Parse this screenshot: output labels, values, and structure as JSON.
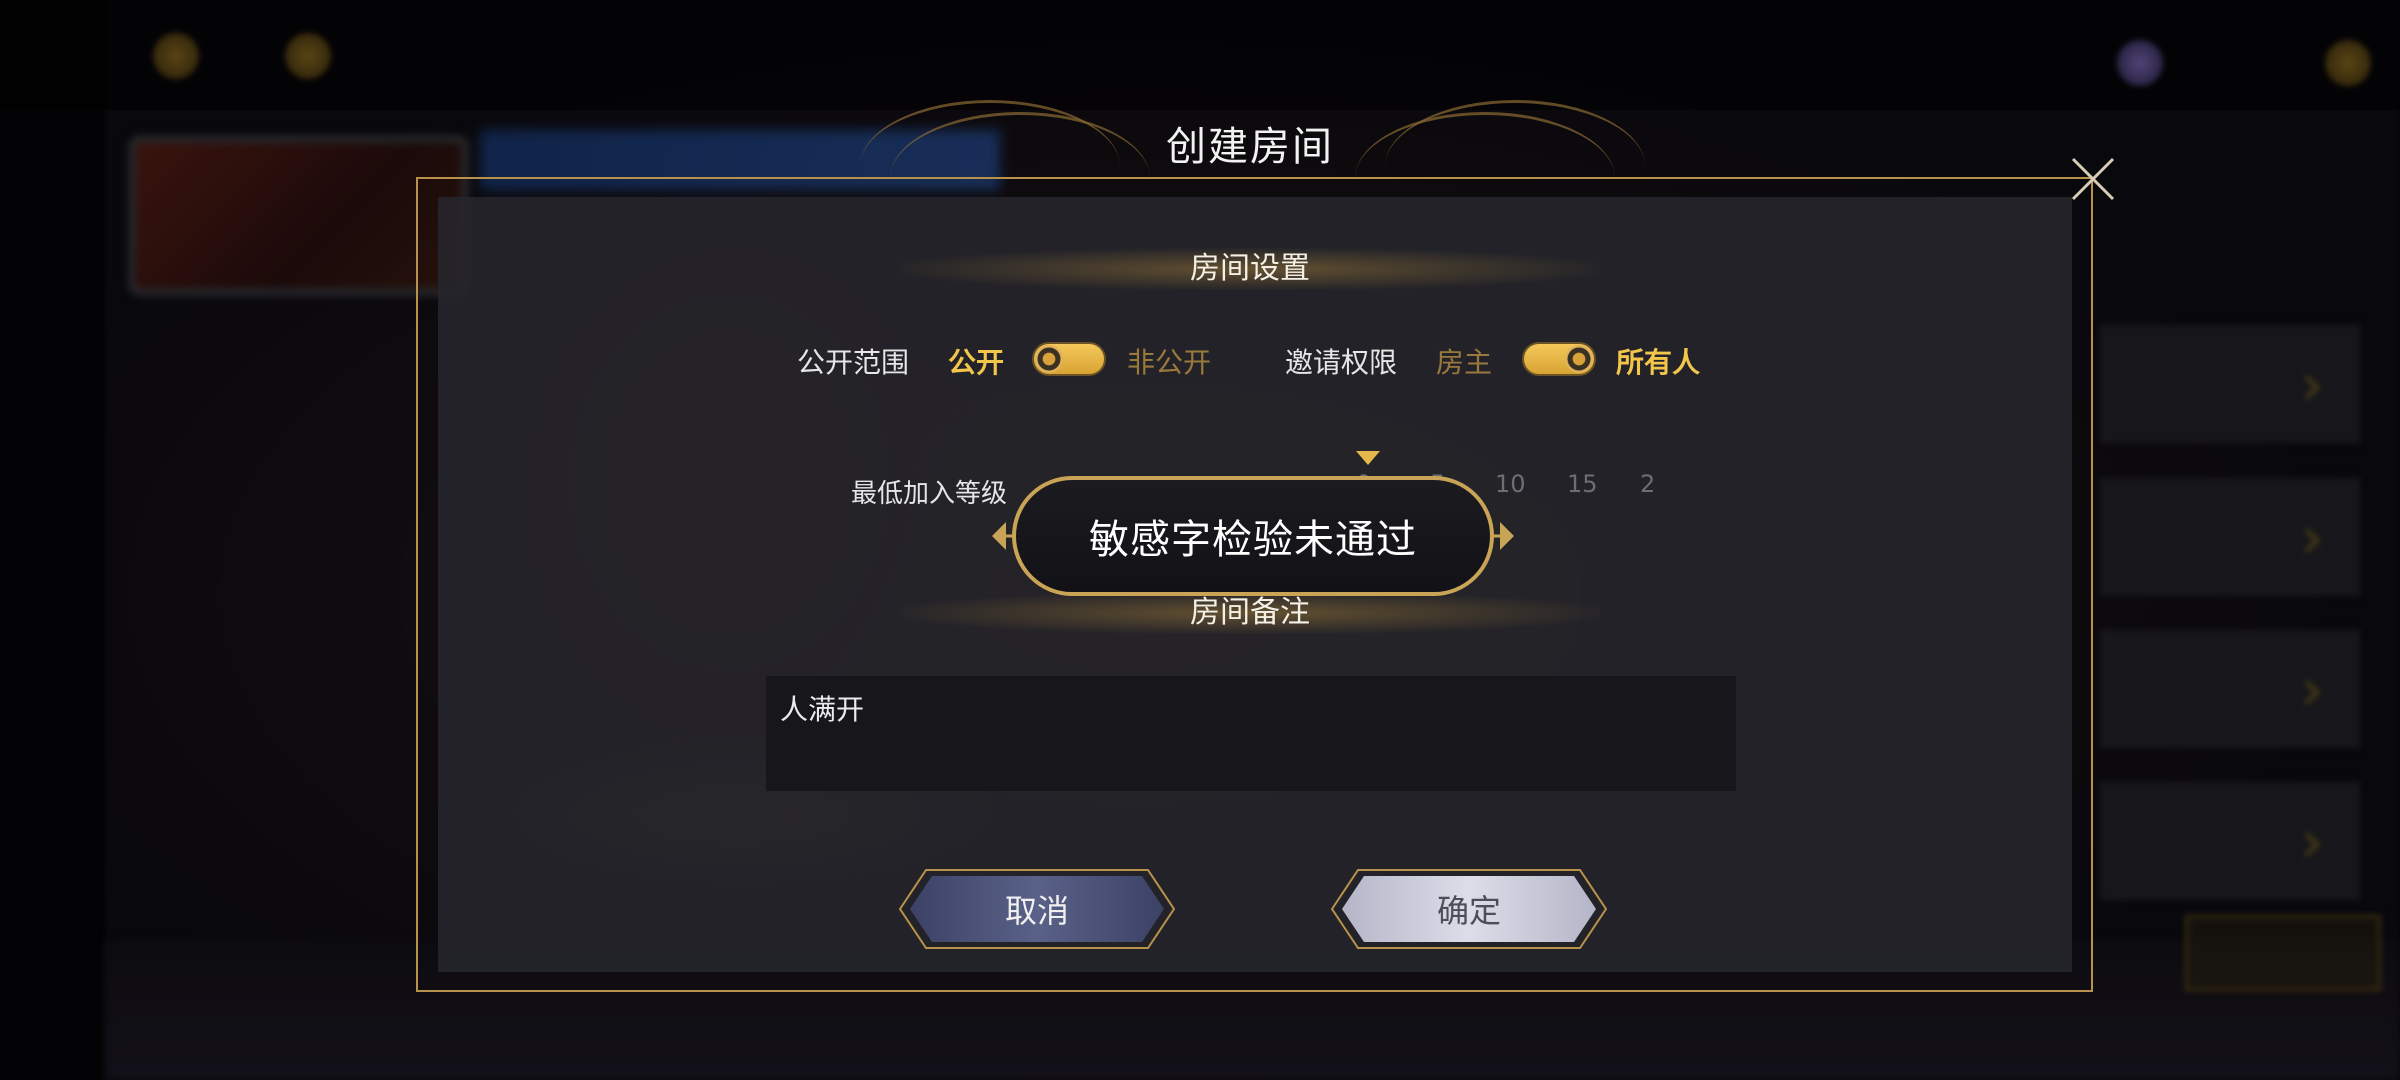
{
  "dialog": {
    "title": "创建房间",
    "close_icon": "close-icon"
  },
  "room_settings": {
    "header": "房间设置",
    "visibility": {
      "label": "公开范围",
      "option_on": "公开",
      "option_off": "非公开",
      "selected": "公开"
    },
    "invite_permission": {
      "label": "邀请权限",
      "option_left": "房主",
      "option_right": "所有人",
      "selected": "所有人"
    },
    "min_level": {
      "label": "最低加入等级",
      "ticks": [
        "0",
        "5",
        "10",
        "15",
        "2"
      ],
      "selected_value": 0
    }
  },
  "room_note": {
    "header": "房间备注",
    "value": "人满开"
  },
  "buttons": {
    "cancel": "取消",
    "confirm": "确定"
  },
  "toast": {
    "message": "敏感字检验未通过"
  },
  "colors": {
    "accent_gold": "#f2c64a",
    "frame_gold": "#b8924a",
    "panel": "#26262c"
  }
}
